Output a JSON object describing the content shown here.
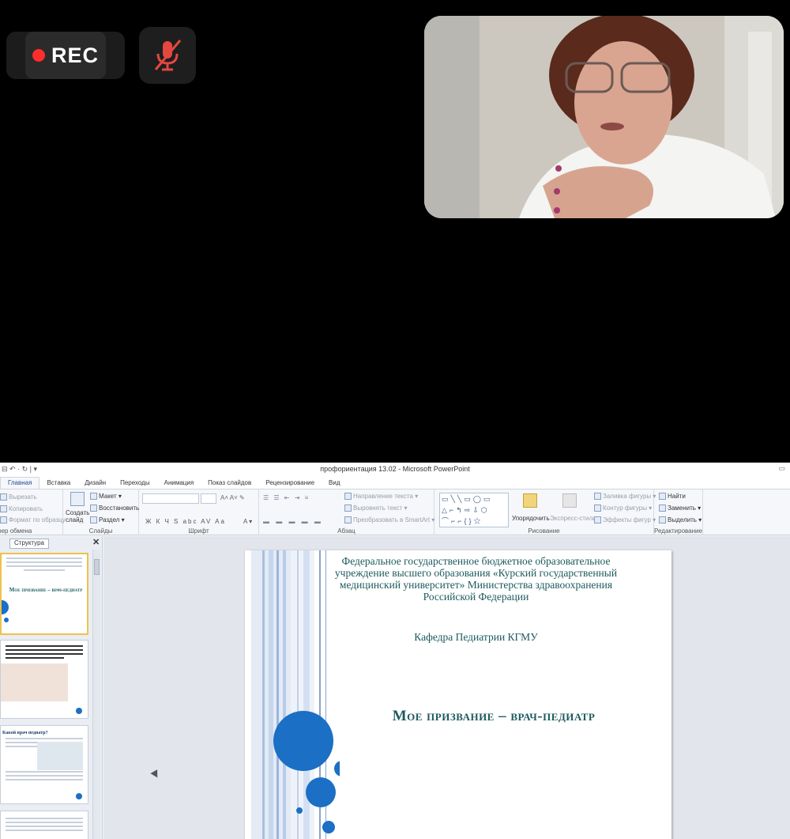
{
  "meeting": {
    "rec_label": "REC",
    "mic_state": "muted",
    "colors": {
      "rec_dot": "#ff2d2d",
      "mic_muted": "#e4473f"
    }
  },
  "icons": [
    "rec-dot-icon",
    "mic-off-icon",
    "save-icon",
    "undo-icon",
    "cut-icon",
    "copy-icon",
    "paste-icon",
    "new-slide-icon",
    "close-icon",
    "find-icon",
    "replace-icon",
    "select-icon"
  ],
  "ppt": {
    "window_title": "профориентация 13.02 - Microsoft PowerPoint",
    "qat": "⊟ ↶ · ↻ | ▾",
    "tabs": [
      "Главная",
      "Вставка",
      "Дизайн",
      "Переходы",
      "Анимация",
      "Показ слайдов",
      "Рецензирование",
      "Вид"
    ],
    "ribbon": {
      "clipboard": {
        "cut": "Вырезать",
        "copy": "Копировать",
        "format": "Формат по образцу",
        "label": "Буфер обмена"
      },
      "slides": {
        "new": "Создать слайд",
        "layout": "Макет",
        "reset": "Восстановить",
        "section": "Раздел",
        "label": "Слайды"
      },
      "font": {
        "label": "Шрифт"
      },
      "paragraph": {
        "dir": "Направление текста",
        "align": "Выровнять текст",
        "smartart": "Преобразовать в SmartArt",
        "label": "Абзац"
      },
      "drawing": {
        "arrange": "Упорядочить",
        "styles": "Экспресс-стили",
        "fill": "Заливка фигуры",
        "outline": "Контур фигуры",
        "effects": "Эффекты фигур",
        "label": "Рисование"
      },
      "editing": {
        "find": "Найти",
        "replace": "Заменить",
        "select": "Выделить",
        "label": "Редактирование"
      }
    },
    "pane": {
      "tab": "Структура"
    },
    "slide": {
      "org": "Федеральное государственное бюджетное образовательное учреждение высшего образования «Курский государственный медицинский университет» Министерства здравоохранения Российской Федерации",
      "dept": "Кафедра Педиатрии КГМУ",
      "title": "Мое призвание – врач-педиатр"
    },
    "thumb1": {
      "title": "Мое призвание – врач-педиатр"
    },
    "thumb3": {
      "title": "Какой врач педиатр?"
    }
  }
}
